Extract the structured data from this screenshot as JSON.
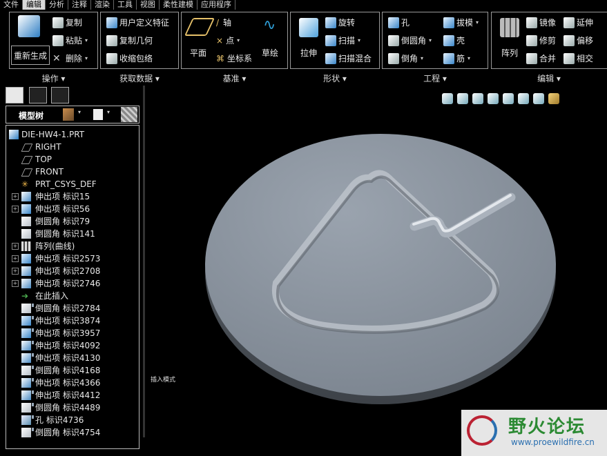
{
  "menu": [
    "文件",
    "编辑",
    "分析",
    "注释",
    "渲染",
    "工具",
    "视图",
    "柔性建模",
    "应用程序"
  ],
  "ribbon": {
    "groups": [
      {
        "name": "操作",
        "buttons": [
          "复制",
          "粘贴",
          "删除",
          "重新生成"
        ]
      },
      {
        "name": "获取数据",
        "buttons": [
          "用户定义特征",
          "复制几何",
          "收缩包络"
        ]
      },
      {
        "name": "基准",
        "buttons": [
          "轴",
          "点",
          "坐标系",
          "平面",
          "草绘"
        ]
      },
      {
        "name": "形状",
        "buttons": [
          "旋转",
          "扫描",
          "扫描混合",
          "拉伸"
        ]
      },
      {
        "name": "工程",
        "buttons": [
          "孔",
          "倒圆角",
          "倒角",
          "拔模",
          "壳",
          "筋"
        ]
      },
      {
        "name": "编辑",
        "buttons": [
          "镜像",
          "修剪",
          "合并",
          "延伸",
          "偏移",
          "相交",
          "阵列"
        ]
      }
    ]
  },
  "panel": {
    "title": "模型树",
    "tree": [
      {
        "label": "DIE-HW4-1.PRT",
        "icon": "part-icon",
        "expand": false,
        "new": false
      },
      {
        "label": "RIGHT",
        "icon": "datum-plane-icon",
        "expand": false,
        "new": false
      },
      {
        "label": "TOP",
        "icon": "datum-plane-icon",
        "expand": false,
        "new": false
      },
      {
        "label": "FRONT",
        "icon": "datum-plane-icon",
        "expand": false,
        "new": false
      },
      {
        "label": "PRT_CSYS_DEF",
        "icon": "csys-icon",
        "expand": false,
        "new": false
      },
      {
        "label": "伸出项 标识15",
        "icon": "revolve-icon",
        "expand": true,
        "new": false
      },
      {
        "label": "伸出项 标识56",
        "icon": "sweep-icon",
        "expand": true,
        "new": false
      },
      {
        "label": "倒圆角 标识79",
        "icon": "round-icon",
        "expand": false,
        "new": false
      },
      {
        "label": "倒圆角 标识141",
        "icon": "round-icon",
        "expand": false,
        "new": false
      },
      {
        "label": "阵列(曲线)",
        "icon": "pattern-icon",
        "expand": true,
        "new": false
      },
      {
        "label": "伸出项 标识2573",
        "icon": "sweep-icon",
        "expand": true,
        "new": false
      },
      {
        "label": "伸出项 标识2708",
        "icon": "revolve-icon",
        "expand": true,
        "new": false
      },
      {
        "label": "伸出项 标识2746",
        "icon": "revolve-icon",
        "expand": true,
        "new": false
      },
      {
        "label": "在此插入",
        "icon": "insert-arrow-icon",
        "expand": false,
        "new": false
      },
      {
        "label": "倒圆角 标识2784",
        "icon": "round-icon",
        "expand": false,
        "new": true
      },
      {
        "label": "伸出项 标识3874",
        "icon": "sweep-icon",
        "expand": false,
        "new": true
      },
      {
        "label": "伸出项 标识3957",
        "icon": "sweep-icon",
        "expand": false,
        "new": true
      },
      {
        "label": "伸出项 标识4092",
        "icon": "revolve-icon",
        "expand": false,
        "new": true
      },
      {
        "label": "伸出项 标识4130",
        "icon": "revolve-icon",
        "expand": false,
        "new": true
      },
      {
        "label": "倒圆角 标识4168",
        "icon": "round-icon",
        "expand": false,
        "new": true
      },
      {
        "label": "伸出项 标识4366",
        "icon": "revolve-icon",
        "expand": false,
        "new": true
      },
      {
        "label": "伸出项 标识4412",
        "icon": "revolve-icon",
        "expand": false,
        "new": true
      },
      {
        "label": "倒圆角 标识4489",
        "icon": "round-icon",
        "expand": false,
        "new": true
      },
      {
        "label": "孔 标识4736",
        "icon": "hole-icon",
        "expand": false,
        "new": true
      },
      {
        "label": "倒圆角 标识4754",
        "icon": "round-icon",
        "expand": false,
        "new": true
      }
    ]
  },
  "graphics": {
    "mode_label": "插入模式"
  },
  "watermark": {
    "site_cn": "野火论坛",
    "url": "www.proewildfire.cn"
  },
  "colors": {
    "model": "#8e97a3",
    "background": "#000000",
    "accent": "#3a86c9"
  }
}
